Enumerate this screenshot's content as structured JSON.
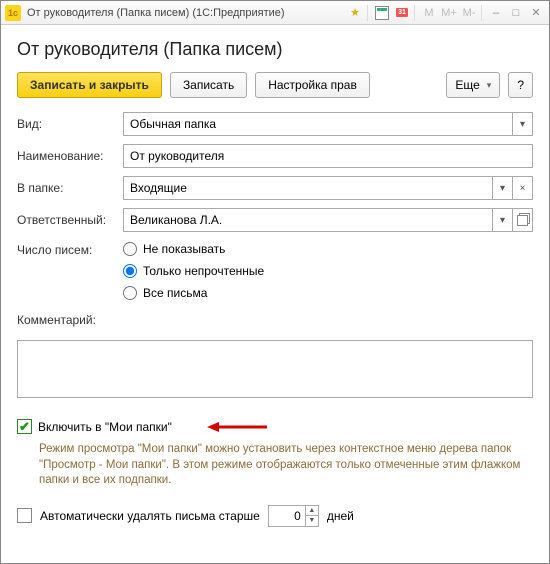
{
  "window": {
    "title": "От руководителя (Папка писем) (1С:Предприятие)"
  },
  "header": {
    "title": "От руководителя (Папка писем)"
  },
  "toolbar": {
    "save_close": "Записать и закрыть",
    "save": "Записать",
    "rights": "Настройка прав",
    "more": "Еще",
    "help": "?"
  },
  "colors": {
    "primary_bg": "#f9cf14",
    "help_text": "#8a6d3b",
    "check_green": "#1a9a1a"
  },
  "form": {
    "kind_label": "Вид:",
    "kind_value": "Обычная папка",
    "name_label": "Наименование:",
    "name_value": "От руководителя",
    "parent_label": "В папке:",
    "parent_value": "Входящие",
    "resp_label": "Ответственный:",
    "resp_value": "Великанова Л.А.",
    "count_label": "Число писем:",
    "count_options": {
      "none": "Не показывать",
      "unread": "Только непрочтенные",
      "all": "Все письма",
      "selected": "unread"
    },
    "comment_label": "Комментарий:",
    "comment_value": ""
  },
  "include": {
    "checked": true,
    "label": "Включить в \"Мои папки\"",
    "help": "Режим просмотра \"Мои папки\" можно установить через контекстное меню дерева папок \"Просмотр - Мои папки\". В этом режиме отображаются только отмеченные этим флажком папки и все их подпапки."
  },
  "autodelete": {
    "checked": false,
    "label": "Автоматически удалять письма старше",
    "days": "0",
    "days_suffix": "дней"
  }
}
